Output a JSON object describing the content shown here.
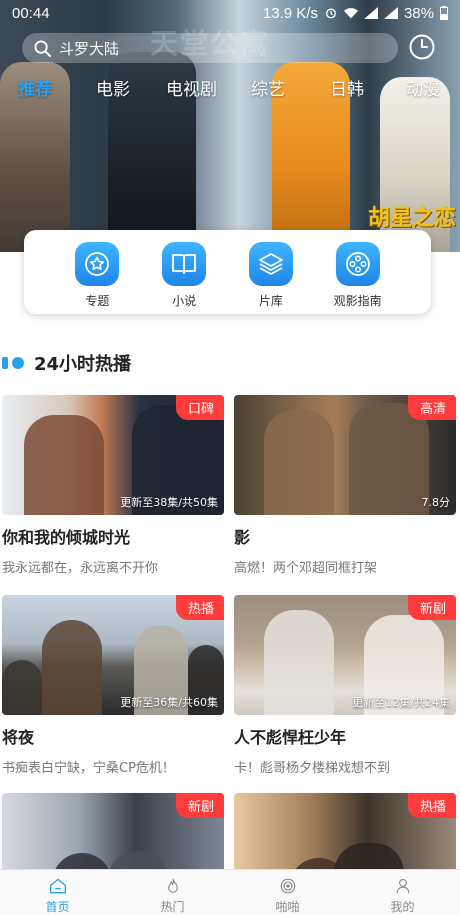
{
  "status_bar": {
    "time": "00:44",
    "speed": "13.9 K/s",
    "battery": "38%"
  },
  "search": {
    "placeholder": "斗罗大陆"
  },
  "banner": {
    "sign_text": "天堂公寓",
    "logo_text": "胡星之恋"
  },
  "categories": [
    {
      "label": "推荐",
      "active": true
    },
    {
      "label": "电影",
      "active": false
    },
    {
      "label": "电视剧",
      "active": false
    },
    {
      "label": "综艺",
      "active": false
    },
    {
      "label": "日韩",
      "active": false
    },
    {
      "label": "动漫",
      "active": false
    }
  ],
  "shortcuts": [
    {
      "label": "专题",
      "icon": "star-icon"
    },
    {
      "label": "小说",
      "icon": "book-icon"
    },
    {
      "label": "片库",
      "icon": "layers-icon"
    },
    {
      "label": "观影指南",
      "icon": "film-reel-icon"
    }
  ],
  "section": {
    "title": "24小时热播"
  },
  "cards": [
    {
      "title": "你和我的倾城时光",
      "desc": "我永远都在，永远离不开你",
      "tag": "口碑",
      "episodes": "更新至38集/共50集",
      "score": ""
    },
    {
      "title": "影",
      "desc": "高燃！两个邓超同框打架",
      "tag": "高清",
      "episodes": "",
      "score": "7.8分"
    },
    {
      "title": "将夜",
      "desc": "书痴表白宁缺，宁桑CP危机！",
      "tag": "热播",
      "episodes": "更新至36集/共60集",
      "score": ""
    },
    {
      "title": "人不彪悍枉少年",
      "desc": "卡！彪哥杨夕楼梯戏想不到",
      "tag": "新剧",
      "episodes": "更新至12集/共24集",
      "score": ""
    },
    {
      "title": "",
      "desc": "",
      "tag": "新剧",
      "episodes": "",
      "score": ""
    },
    {
      "title": "",
      "desc": "",
      "tag": "热播",
      "episodes": "",
      "score": ""
    }
  ],
  "bottom_nav": [
    {
      "label": "首页",
      "icon": "home-icon",
      "active": true
    },
    {
      "label": "热门",
      "icon": "flame-icon",
      "active": false
    },
    {
      "label": "啪啪",
      "icon": "target-icon",
      "active": false
    },
    {
      "label": "我的",
      "icon": "user-icon",
      "active": false
    }
  ],
  "colors": {
    "accent": "#2aa0f0",
    "tag_red": "#ff3b3b"
  }
}
